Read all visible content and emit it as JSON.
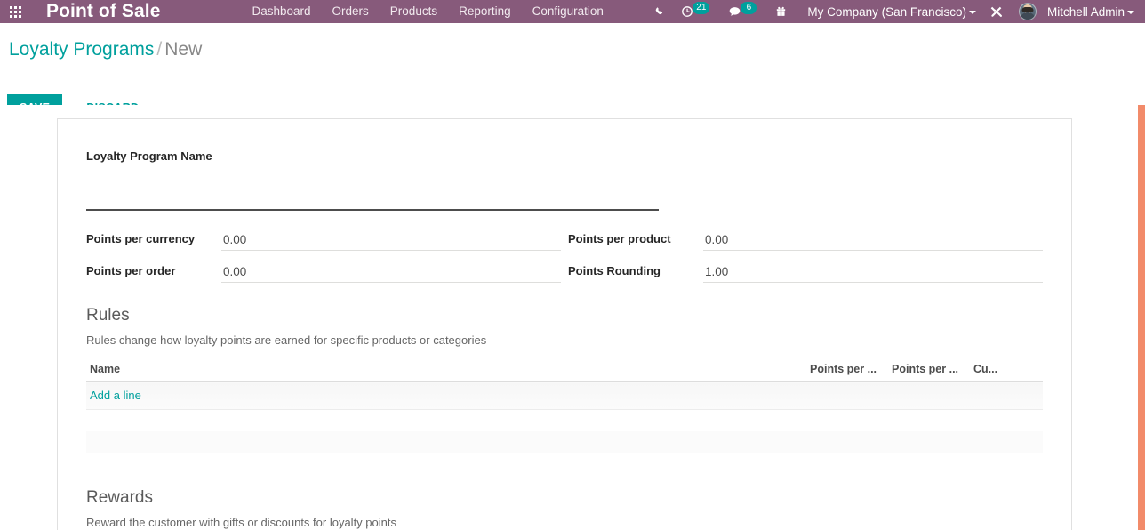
{
  "navbar": {
    "apps_icon": "apps-grid-icon",
    "brand": "Point of Sale",
    "menu": [
      {
        "label": "Dashboard"
      },
      {
        "label": "Orders"
      },
      {
        "label": "Products"
      },
      {
        "label": "Reporting"
      },
      {
        "label": "Configuration"
      }
    ],
    "icons": {
      "phone": "phone-icon",
      "activity": "clock-activity-icon",
      "messages": "chat-bubble-icon",
      "gift": "gift-icon",
      "tools": "tools-wrench-icon"
    },
    "activity_count": "21",
    "messages_count": "6",
    "company": "My Company (San Francisco)",
    "user": "Mitchell Admin",
    "accent_color": "#875A7B",
    "badge_color": "#00A09D"
  },
  "control_panel": {
    "breadcrumb_root": "Loyalty Programs",
    "breadcrumb_separator": "/",
    "breadcrumb_current": "New",
    "save_label": "SAVE",
    "discard_label": "DISCARD",
    "save_color": "#00A09D"
  },
  "form": {
    "name_label": "Loyalty Program Name",
    "name_value": "",
    "name_placeholder": "",
    "fields_left": [
      {
        "label": "Points per currency",
        "value": "0.00"
      },
      {
        "label": "Points per order",
        "value": "0.00"
      }
    ],
    "fields_right": [
      {
        "label": "Points per product",
        "value": "0.00"
      },
      {
        "label": "Points Rounding",
        "value": "1.00"
      }
    ]
  },
  "rules": {
    "title": "Rules",
    "subtitle": "Rules change how loyalty points are earned for specific products or categories",
    "columns": [
      "Name",
      "Points per ...",
      "Points per ...",
      "Cu..."
    ],
    "add_line_label": "Add a line",
    "rows": []
  },
  "rewards": {
    "title": "Rewards",
    "subtitle": "Reward the customer with gifts or discounts for loyalty points"
  },
  "scrollbar": {
    "thumb_color": "#F28B6A"
  }
}
